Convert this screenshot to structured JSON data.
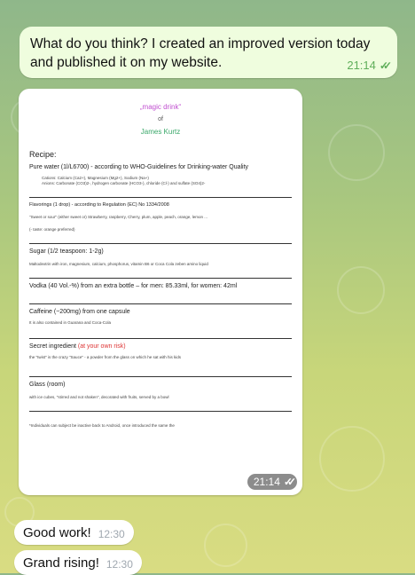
{
  "messages": {
    "outgoing_text": {
      "text": "What do you think? I created an improved version today and published it on my website.",
      "time": "21:14",
      "ticks": "✓✓"
    },
    "outgoing_image": {
      "time": "21:14",
      "ticks": "✓✓"
    },
    "incoming": [
      {
        "text": "Good work!",
        "time": "12:30"
      },
      {
        "text": "Grand rising!",
        "time": "12:30"
      }
    ]
  },
  "recipe_image": {
    "title": "„magic drink“",
    "of": "of",
    "author": "James Kurtz",
    "recipe_heading": "Recipe:",
    "sections": [
      {
        "heading": "Pure water (1l/L6700) - according to WHO-Guidelines for Drinking-water Quality",
        "lines": [
          "Cations: Calcium (Ca2+), Magnesium (Mg2+), Sodium (Na+)",
          "Anions: Carbonate (CO3)2-, hydrogen carbonate (HCO3-), chloride (Cl-) and sulfate (SO4)2-"
        ]
      },
      {
        "heading": "Flavorings (1 drop) - according to Regulation (EC) No 1334/2008",
        "lines": [
          "\"Sweet or sour\" (either sweet or) Strawberry, raspberry, Cherry, plum, apple, peach, orange, lemon ...",
          "(- taste: orange preferred)"
        ]
      },
      {
        "heading": "Sugar (1/2 teaspoon: 1-2g)",
        "lines": [
          "Maltodextrin with iron, magnesium, calcium, phosphorus, vitamin B6 or Coca Cola zeben amino liquid"
        ]
      },
      {
        "heading": "Vodka (40 Vol.-%) from an extra bottle – for men: 85.33ml, for women: 42ml",
        "lines": []
      },
      {
        "heading": "Caffeine (~200mg) from one capsule",
        "lines": [
          "It is also contained in Guarana and Coca-Cola"
        ]
      },
      {
        "heading": "Secret ingredient",
        "heading_extra": "(at your own risk)",
        "lines": [
          "the \"twist\" is the crazy \"Sauce\" - a powder from the glass on which he sat with his kids"
        ]
      },
      {
        "heading": "Glass (room)",
        "lines": [
          "with ice cubes, \"stirred and not shaken\", decorated with fruits, served by a bowl"
        ]
      }
    ],
    "footnote": "*Individuals can subject be inactive back to Android, once introduced the same the"
  },
  "colors": {
    "outgoing_bubble": "#effdde",
    "incoming_bubble": "#ffffff",
    "time_green": "#5fae5a"
  }
}
